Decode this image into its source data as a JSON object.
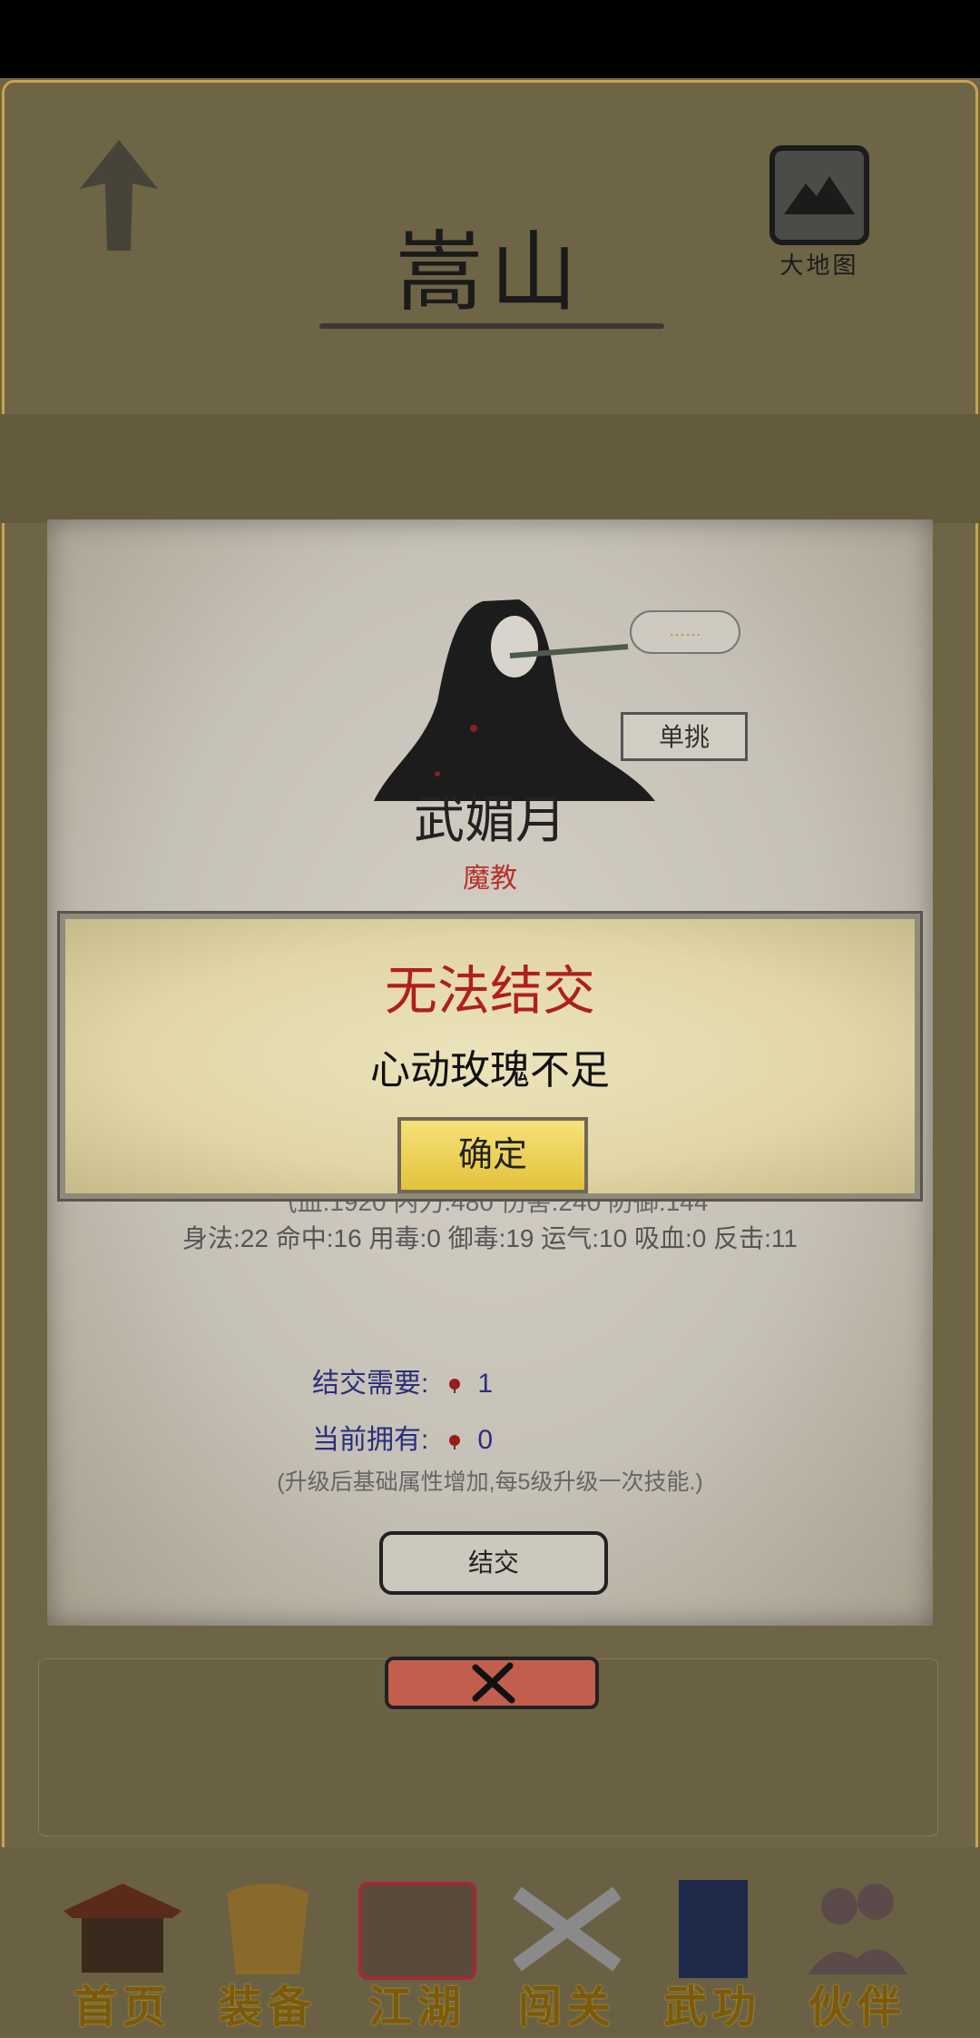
{
  "header": {
    "title": "嵩山",
    "map_label": "大地图"
  },
  "npc": {
    "speech": "……",
    "duel_label": "单挑",
    "name": "武媚月",
    "faction": "魔教",
    "stats_line1": "气血:1920  内力:480  伤害:240  防御:144",
    "stats_line2": "身法:22  命中:16  用毒:0  御毒:19  运气:10  吸血:0  反击:11",
    "befriend_need_label": "结交需要:",
    "befriend_need_value": "1",
    "owned_label": "当前拥有:",
    "owned_value": "0",
    "note": "(升级后基础属性增加,每5级升级一次技能.)",
    "befriend_button": "结交"
  },
  "alert": {
    "title": "无法结交",
    "message": "心动玫瑰不足",
    "ok_label": "确定"
  },
  "nav": [
    {
      "label": "首页",
      "icon": "temple-icon"
    },
    {
      "label": "装备",
      "icon": "armor-icon"
    },
    {
      "label": "江湖",
      "icon": "scroll-map-icon"
    },
    {
      "label": "闯关",
      "icon": "crossed-swords-icon"
    },
    {
      "label": "武功",
      "icon": "book-icon"
    },
    {
      "label": "伙伴",
      "icon": "companions-icon"
    }
  ],
  "colors": {
    "accent_red": "#b01f1b",
    "button_yellow": "#f0d35a",
    "close_red": "#c25e4e"
  }
}
